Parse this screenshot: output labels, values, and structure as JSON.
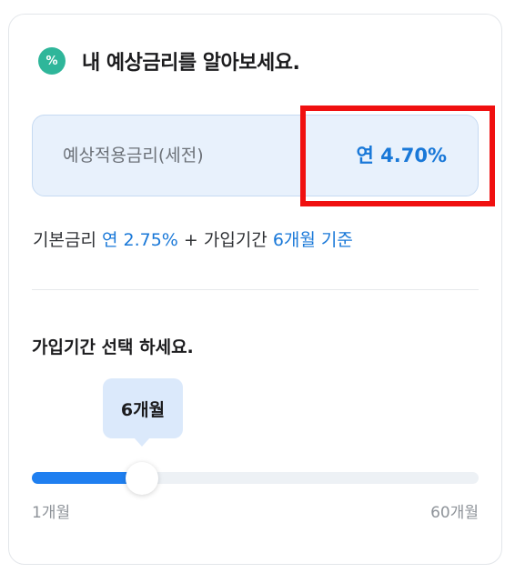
{
  "header": {
    "icon": "percent-icon",
    "title": "내 예상금리를 알아보세요."
  },
  "rate": {
    "label": "예상적용금리(세전)",
    "value": "연 4.70%"
  },
  "base": {
    "prefix": "기본금리 ",
    "base_rate": "연 2.75%",
    "middle": " + 가입기간 ",
    "period": "6개월 기준"
  },
  "period_selector": {
    "title": "가입기간 선택 하세요.",
    "selected_label": "6개월",
    "min_label": "1개월",
    "max_label": "60개월",
    "value_months": 6,
    "min_months": 1,
    "max_months": 60
  },
  "colors": {
    "accent": "#1978d8",
    "highlight": "#f01010",
    "icon_bg": "#2fb69a"
  }
}
